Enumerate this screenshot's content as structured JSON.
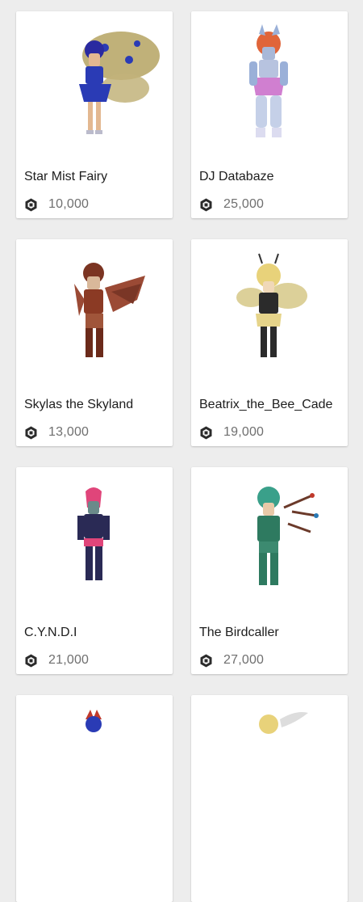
{
  "items": [
    {
      "name": "Star Mist Fairy",
      "price": "10,000",
      "icon": "robux-icon",
      "colors": {
        "body": "#2a3bb5",
        "wing": "#b9a86a",
        "hair": "#2a2aa0"
      }
    },
    {
      "name": "DJ Databaze",
      "price": "25,000",
      "icon": "robux-icon",
      "colors": {
        "body": "#d07fd0",
        "wing": "#9ab0d8",
        "hair": "#e0653a"
      }
    },
    {
      "name": "Skylas the Skyland",
      "price": "13,000",
      "icon": "robux-icon",
      "colors": {
        "body": "#8b3a24",
        "wing": "#9b4a35",
        "hair": "#7b3422"
      }
    },
    {
      "name": "Beatrix_the_Bee_Cade",
      "price": "19,000",
      "icon": "robux-icon",
      "colors": {
        "body": "#2b2b2b",
        "wing": "#c8b870",
        "hair": "#e8d27a"
      }
    },
    {
      "name": "C.Y.N.D.I",
      "price": "21,000",
      "icon": "robux-icon",
      "colors": {
        "body": "#2a2a55",
        "wing": "#ffffff",
        "hair": "#e0457a"
      }
    },
    {
      "name": "The Birdcaller",
      "price": "27,000",
      "icon": "robux-icon",
      "colors": {
        "body": "#2e7a60",
        "wing": "#6b3a2a",
        "hair": "#3aa08a"
      }
    }
  ],
  "peek": [
    {
      "colors": {
        "body": "#2a3bb5",
        "hair": "#c0392b"
      }
    },
    {
      "colors": {
        "body": "#b9a86a",
        "hair": "#e8d27a"
      }
    }
  ]
}
